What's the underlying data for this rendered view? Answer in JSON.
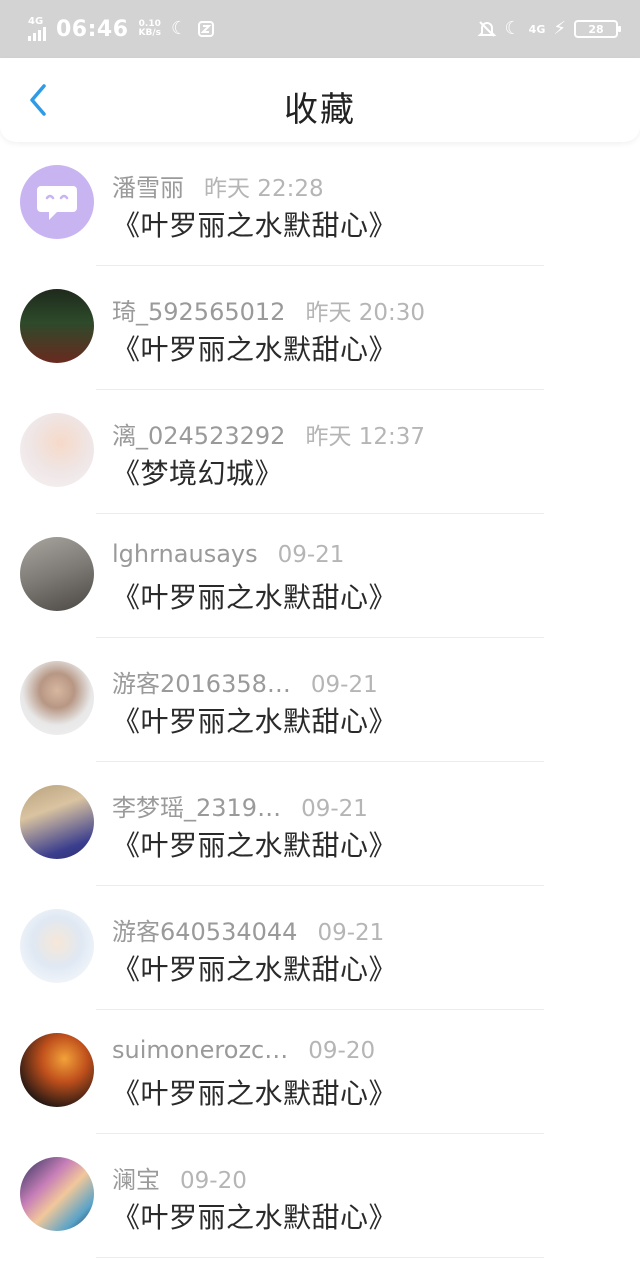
{
  "status_bar": {
    "network": "4G",
    "time": "06:46",
    "speed_value": "0.10",
    "speed_unit": "KB/s",
    "network_right": "4G",
    "battery": "28"
  },
  "header": {
    "title": "收藏"
  },
  "favorites": [
    {
      "user": "潘雪丽",
      "time": "昨天 22:28",
      "book": "《叶罗丽之水默甜心》"
    },
    {
      "user": "琦_592565012",
      "time": "昨天 20:30",
      "book": "《叶罗丽之水默甜心》"
    },
    {
      "user": "漓_024523292",
      "time": "昨天 12:37",
      "book": "《梦境幻城》"
    },
    {
      "user": "lghrnausays",
      "time": "09-21",
      "book": "《叶罗丽之水默甜心》"
    },
    {
      "user": "游客2016358…",
      "time": "09-21",
      "book": "《叶罗丽之水默甜心》"
    },
    {
      "user": "李梦瑶_2319…",
      "time": "09-21",
      "book": "《叶罗丽之水默甜心》"
    },
    {
      "user": "游客640534044",
      "time": "09-21",
      "book": "《叶罗丽之水默甜心》"
    },
    {
      "user": "suimonerozc…",
      "time": "09-20",
      "book": "《叶罗丽之水默甜心》"
    },
    {
      "user": "澜宝",
      "time": "09-20",
      "book": "《叶罗丽之水默甜心》"
    }
  ],
  "colors": {
    "status_bar_bg": "#d3d3d3",
    "accent": "#2f9be8",
    "default_avatar": "#c9b4f2"
  }
}
